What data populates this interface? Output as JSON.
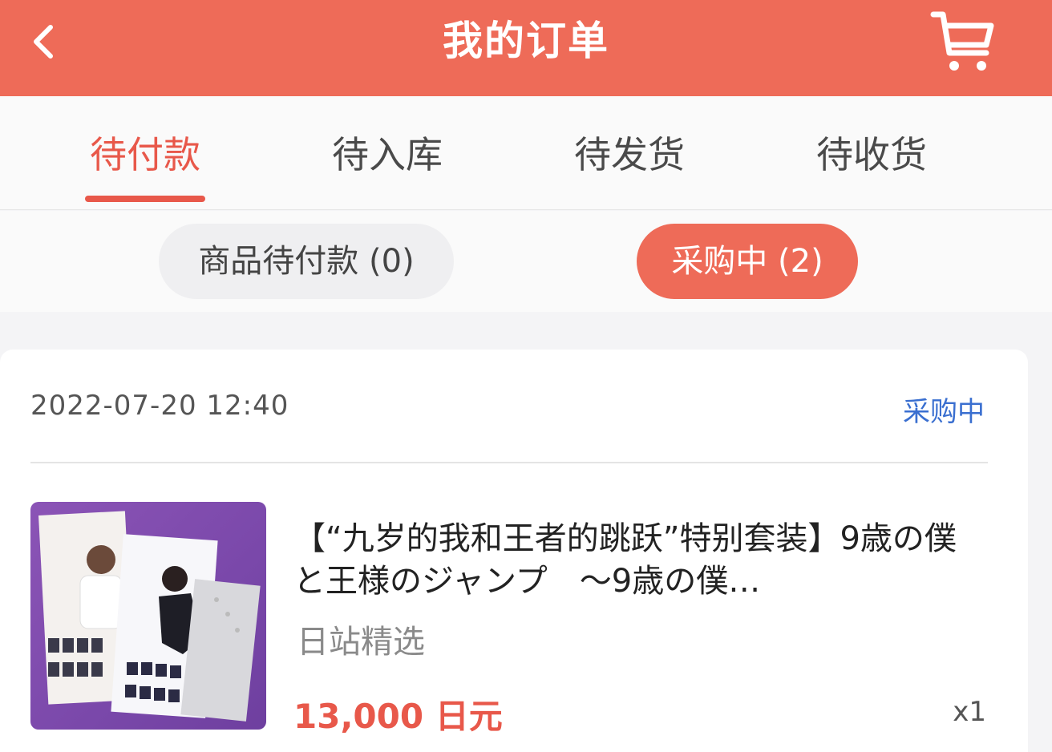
{
  "header": {
    "title": "我的订单",
    "back_icon": "chevron-left-icon",
    "cart_icon": "shopping-cart-icon",
    "background": "#ee6b58"
  },
  "tabs": [
    {
      "label": "待付款",
      "active": true
    },
    {
      "label": "待入库",
      "active": false
    },
    {
      "label": "待发货",
      "active": false
    },
    {
      "label": "待收货",
      "active": false
    }
  ],
  "subtabs": [
    {
      "label": "商品待付款 (0)",
      "active": false
    },
    {
      "label": "采购中 (2)",
      "active": true
    }
  ],
  "order": {
    "time": "2022-07-20 12:40",
    "status": "采购中",
    "product_title": "【“九岁的我和王者的跳跃”特别套装】9歳の僕と王様のジャンプ　～9歳の僕…",
    "store": "日站精选",
    "price": "13,000 日元",
    "quantity": "x1"
  },
  "colors": {
    "accent": "#e8584a",
    "status_blue": "#3a6fd0"
  }
}
